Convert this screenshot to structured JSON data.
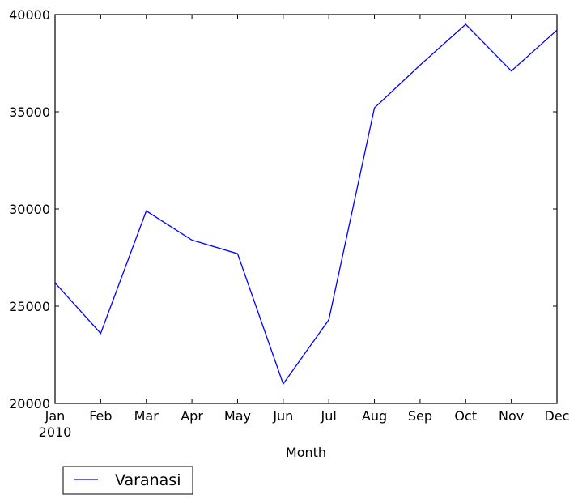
{
  "chart_data": {
    "type": "line",
    "title": "",
    "xlabel": "Month",
    "ylabel": "",
    "categories": [
      "Jan",
      "Feb",
      "Mar",
      "Apr",
      "May",
      "Jun",
      "Jul",
      "Aug",
      "Sep",
      "Oct",
      "Nov",
      "Dec"
    ],
    "x_sublabel": "2010",
    "ylim": [
      20000,
      40000
    ],
    "yticks": [
      20000,
      25000,
      30000,
      35000,
      40000
    ],
    "grid": false,
    "legend_position": "below-left",
    "series": [
      {
        "name": "Varanasi",
        "color": "#0000ff",
        "values": [
          26200,
          23600,
          29900,
          28400,
          27700,
          21000,
          24300,
          35200,
          37400,
          39500,
          37100,
          39200
        ]
      }
    ]
  }
}
